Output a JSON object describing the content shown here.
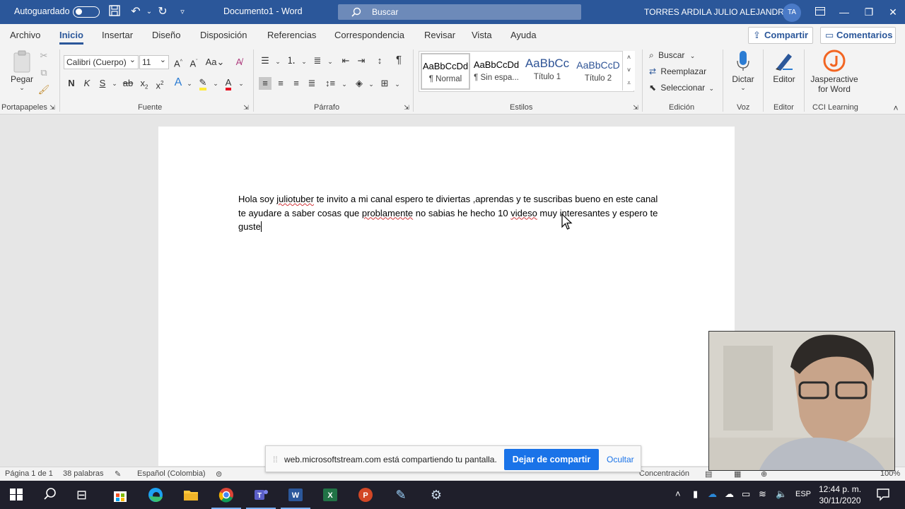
{
  "titlebar": {
    "autosave_label": "Autoguardado",
    "doc_title": "Documento1  -  Word",
    "search_placeholder": "Buscar",
    "user_name": "TORRES ARDILA JULIO ALEJANDRO",
    "user_initials": "TA",
    "accent": "#2b579a"
  },
  "tabs": [
    "Archivo",
    "Inicio",
    "Insertar",
    "Diseño",
    "Disposición",
    "Referencias",
    "Correspondencia",
    "Revisar",
    "Vista",
    "Ayuda"
  ],
  "active_tab": "Inicio",
  "actions": {
    "share": "Compartir",
    "comments": "Comentarios"
  },
  "ribbon": {
    "clipboard": {
      "paste": "Pegar",
      "group": "Portapapeles"
    },
    "font": {
      "name": "Calibri (Cuerpo)",
      "size": "11",
      "bold": "N",
      "italic": "K",
      "underline": "S",
      "group": "Fuente"
    },
    "paragraph": {
      "group": "Párrafo"
    },
    "styles": {
      "group": "Estilos",
      "items": [
        {
          "preview": "AaBbCcDd",
          "name": "¶ Normal"
        },
        {
          "preview": "AaBbCcDd",
          "name": "¶ Sin espa..."
        },
        {
          "preview": "AaBbCc",
          "name": "Título 1"
        },
        {
          "preview": "AaBbCcD",
          "name": "Título 2"
        }
      ]
    },
    "editing": {
      "find": "Buscar",
      "replace": "Reemplazar",
      "select": "Seleccionar",
      "group": "Edición"
    },
    "voice": {
      "dictate": "Dictar",
      "group": "Voz"
    },
    "editor": {
      "editor": "Editor",
      "group": "Editor"
    },
    "addin": {
      "name_line1": "Jasperactive",
      "name_line2": "for Word",
      "group": "CCI Learning"
    }
  },
  "document": {
    "segments": [
      "Hola soy ",
      "juliotuber",
      " te invito a mi canal espero te diviertas ,aprendas y te suscribas bueno en este canal te ayudare a saber cosas que ",
      "problamente",
      " no sabias he hecho 10 ",
      "videso",
      " muy interesantes y espero te guste"
    ]
  },
  "sharebar": {
    "message": "web.microsoftstream.com está compartiendo tu pantalla.",
    "stop": "Dejar de compartir",
    "hide": "Ocultar"
  },
  "statusbar": {
    "page": "Página 1 de 1",
    "words": "38 palabras",
    "language": "Español (Colombia)",
    "focus": "Concentración",
    "zoom": "100%"
  },
  "taskbar": {
    "time": "12:44 p. m.",
    "date": "30/11/2020",
    "lang": "ESP"
  }
}
